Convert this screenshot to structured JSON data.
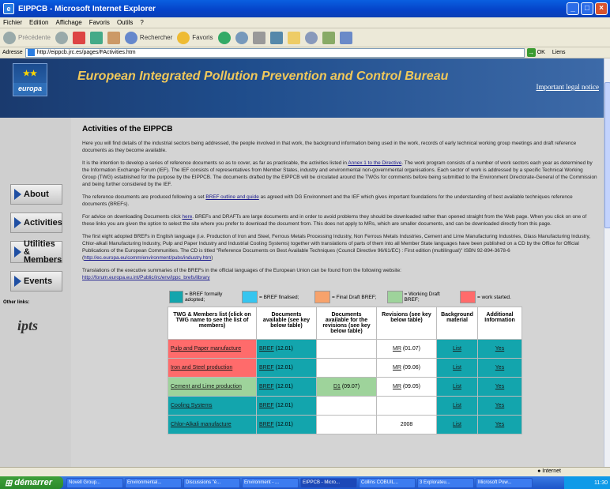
{
  "window": {
    "title": "EIPPCB - Microsoft Internet Explorer"
  },
  "menu": [
    "Fichier",
    "Edition",
    "Affichage",
    "Favoris",
    "Outils",
    "?"
  ],
  "toolbar": {
    "back": "Précédente",
    "search": "Rechercher",
    "favorites": "Favoris"
  },
  "address": {
    "label": "Adresse",
    "url": "http://eippcb.jrc.es/pages/FActivities.htm",
    "go": "OK",
    "links": "Liens"
  },
  "banner": {
    "logo_text": "europa",
    "title": "European Integrated Pollution Prevention and Control Bureau",
    "legal": "Important legal notice"
  },
  "nav": {
    "about": "About",
    "activities": "Activities",
    "utilities1": "Utilities &",
    "utilities2": "Members",
    "events": "Events",
    "other_links": "Other links:"
  },
  "main": {
    "title": "Activities of the EIPPCB",
    "p1": "Here you will find details of the industrial sectors being addressed, the people involved in that work, the background information being used in the work, records of early technical working group meetings and draft reference documents as they become available.",
    "p2a": "It is the intention to develop a series of reference documents so as to cover, as far as practicable, the activities listed in ",
    "p2link": "Annex 1 to the Directive",
    "p2b": ". The work program consists of a number of work sectors each year as determined by the Information Exchange Forum (IEF). The IEF consists of representatives from Member States, industry and environmental non-governmental organisations. Each sector of work is addressed by a specific Technical Working Group (TWG) established for the purpose by the EIPPCB. The documents drafted by the EIPPCB will be circulated around the TWGs for comments before being submitted to the Environment Directorate-General of the Commission and being further considered by the IEF.",
    "p3a": "The reference documents are produced following a set ",
    "p3link": "BREF outline and guide",
    "p3b": " as agreed with DG Environment and the IEF which gives important foundations for the understanding of best available techniques reference documents (BREFs).",
    "p4a": "For advice on downloading Documents click ",
    "p4link": "here",
    "p4b": ". BREFs and DRAFTs are large documents and in order to avoid problems they should be downloaded rather than opened straight from the Web page. When you click on one of these links you are given the option to select the site where you prefer to download the document from. This does not apply to MRs, which are smaller documents, and can be downloaded directly from this page.",
    "p5": "The first eight adopted BREFs in English language (i.e. Production of Iron and Steel, Ferrous Metals Processing Industry, Non Ferrous Metals Industries, Cement and Lime Manufacturing Industries, Glass Manufacturing Industry, Chlor-alkali Manufacturing Industry, Pulp and Paper Industry and Industrial Cooling Systems) together with translations of parts of them into all Member State languages have been published on a CD by the Office for Official Publications of the European Communities. The CD is titled \"Reference Documents on Best Available Techniques (Council Directive 96/61/EC) : First edition (multilingual)\" ISBN 92-894-3678-6 (",
    "p5link": "http://ec.europa.eu/comm/environment/pubs/industry.htm",
    "p5end": ")",
    "p6": "Translations of the executive summaries of the BREFs in the official languages of the European Union can be found from the following website:",
    "p6link": "http://forum.europa.eu.int/Public/irc/env/ippc_brefs/library"
  },
  "legend": [
    {
      "label": "= BREF formally adopted;",
      "color": "#13a5ad"
    },
    {
      "label": "= BREF finalised;",
      "color": "#36c5ef"
    },
    {
      "label": "= Final Draft BREF;",
      "color": "#f7a26b"
    },
    {
      "label": "= Working Draft BREF;",
      "color": "#9ed39b"
    },
    {
      "label": "= work started.",
      "color": "#ff6b6b"
    }
  ],
  "table": {
    "headers": [
      "TWG & Members list (click on TWG name to see the list of members)",
      "Documents available (see key below table)",
      "Documents available for the revisions (see key below table)",
      "Revisions (see key below table)",
      "Background material",
      "Additional Information"
    ],
    "rows": [
      {
        "twg": "Pulp and Paper manufacture",
        "docs": "BREF",
        "docs_date": " (12.01)",
        "rev_docs": "",
        "rev_docs_date": "",
        "rev": "MR",
        "rev_date": " (01.07)",
        "bg": "List",
        "info": "Yes"
      },
      {
        "twg": "Iron and Steel production",
        "docs": "BREF",
        "docs_date": " (12.01)",
        "rev_docs": "",
        "rev_docs_date": "",
        "rev": "MR",
        "rev_date": " (09.06)",
        "bg": "List",
        "info": "Yes"
      },
      {
        "twg": "Cement and Lime production",
        "docs": "BREF",
        "docs_date": " (12.01)",
        "rev_docs": "D1",
        "rev_docs_date": " (09.07)",
        "rev": "MR",
        "rev_date": " (09.05)",
        "bg": "List",
        "info": "Yes"
      },
      {
        "twg": "Cooling Systems",
        "docs": "BREF",
        "docs_date": " (12.01)",
        "rev_docs": "",
        "rev_docs_date": "",
        "rev": "",
        "rev_date": "",
        "bg": "List",
        "info": "Yes"
      },
      {
        "twg": "Chlor-Alkali manufacture",
        "docs": "BREF",
        "docs_date": " (12.01)",
        "rev_docs": "",
        "rev_docs_date": "",
        "rev": "2008",
        "rev_date": "",
        "bg": "List",
        "info": "Yes"
      }
    ]
  },
  "status": {
    "zone": "Internet"
  },
  "taskbar": {
    "start": "démarrer",
    "tasks": [
      "Novell Group...",
      "Environmental...",
      "Discussions \"é...",
      "Environment - ...",
      "EIPPCB - Micro...",
      "Collins COBUIL...",
      "3 Explorateu...",
      "Microsoft Pow..."
    ],
    "clock": "11:30"
  }
}
